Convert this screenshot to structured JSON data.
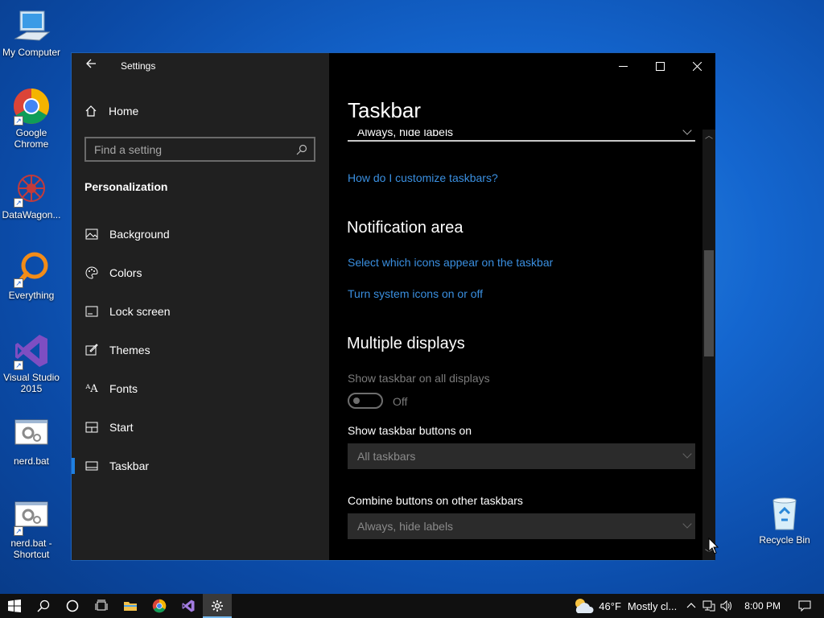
{
  "desktop": {
    "icons": [
      {
        "label": "My Computer",
        "icon": "computer-icon"
      },
      {
        "label": "Google Chrome",
        "icon": "chrome-icon"
      },
      {
        "label": "DataWagon...",
        "icon": "datawagon-icon"
      },
      {
        "label": "Everything",
        "icon": "everything-search-icon"
      },
      {
        "label": "Visual Studio 2015",
        "icon": "visual-studio-icon"
      },
      {
        "label": "nerd.bat",
        "icon": "batch-file-icon"
      },
      {
        "label": "nerd.bat - Shortcut",
        "icon": "batch-file-icon"
      },
      {
        "label": "Recycle Bin",
        "icon": "recycle-bin-icon"
      }
    ]
  },
  "window": {
    "title": "Settings",
    "controls": {
      "minimize": "minimize-icon",
      "maximize": "maximize-icon",
      "close": "close-icon"
    }
  },
  "nav": {
    "home_label": "Home",
    "search_placeholder": "Find a setting",
    "section_title": "Personalization",
    "items": [
      {
        "label": "Background",
        "icon": "picture-icon"
      },
      {
        "label": "Colors",
        "icon": "palette-icon"
      },
      {
        "label": "Lock screen",
        "icon": "lock-screen-icon"
      },
      {
        "label": "Themes",
        "icon": "brush-icon"
      },
      {
        "label": "Fonts",
        "icon": "font-icon"
      },
      {
        "label": "Start",
        "icon": "start-icon"
      },
      {
        "label": "Taskbar",
        "icon": "taskbar-icon",
        "active": true
      }
    ]
  },
  "main": {
    "page_title": "Taskbar",
    "top_dropdown_value": "Always, hide labels",
    "customize_link": "How do I customize taskbars?",
    "notification_area": {
      "heading": "Notification area",
      "link_icons": "Select which icons appear on the taskbar",
      "link_system": "Turn system icons on or off"
    },
    "multiple_displays": {
      "heading": "Multiple displays",
      "show_all_label": "Show taskbar on all displays",
      "toggle_state": "Off",
      "buttons_on_label": "Show taskbar buttons on",
      "buttons_on_value": "All taskbars",
      "combine_label": "Combine buttons on other taskbars",
      "combine_value": "Always, hide labels"
    }
  },
  "taskbar": {
    "weather_temp": "46°F",
    "weather_desc": "Mostly cl...",
    "time": "8:00 PM"
  },
  "colors": {
    "accent": "#1f7fe0",
    "link": "#3a8fe0",
    "nav_bg": "#202020",
    "content_bg": "#000000"
  }
}
